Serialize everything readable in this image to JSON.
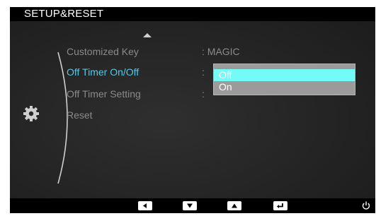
{
  "osd": {
    "title": "SETUP&RESET",
    "menu": [
      {
        "label": "Customized Key",
        "value": ": MAGIC"
      },
      {
        "label": "Off Timer On/Off",
        "value": ":"
      },
      {
        "label": "Off Timer Setting",
        "value": ":"
      },
      {
        "label": "Reset",
        "value": ""
      }
    ],
    "selected_index": 1,
    "dropdown": {
      "options": [
        "Off",
        "On"
      ],
      "highlighted": "Off"
    },
    "footer_buttons": [
      "left-arrow-icon",
      "down-arrow-icon",
      "up-arrow-icon",
      "enter-icon",
      "power-icon"
    ],
    "colors": {
      "selected_text": "#56c8e6",
      "highlight": "#73fbf7",
      "background": "#262626"
    }
  }
}
